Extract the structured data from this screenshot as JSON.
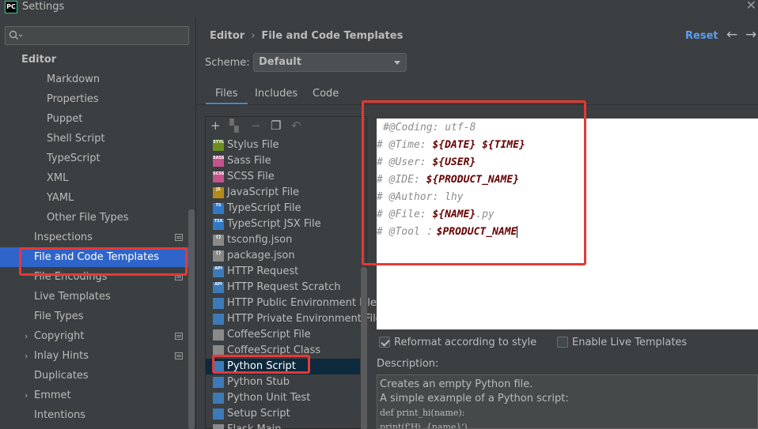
{
  "window": {
    "title": "Settings",
    "logo": "PC"
  },
  "sidebar": {
    "search_placeholder": "",
    "group_label": "Editor",
    "sub_items": [
      {
        "label": "Markdown"
      },
      {
        "label": "Properties"
      },
      {
        "label": "Puppet"
      },
      {
        "label": "Shell Script"
      },
      {
        "label": "TypeScript"
      },
      {
        "label": "XML"
      },
      {
        "label": "YAML"
      },
      {
        "label": "Other File Types"
      }
    ],
    "items": [
      {
        "label": "Inspections",
        "gear": true
      },
      {
        "label": "File and Code Templates",
        "selected": true
      },
      {
        "label": "File Encodings",
        "gear": true
      },
      {
        "label": "Live Templates"
      },
      {
        "label": "File Types"
      },
      {
        "label": "Copyright",
        "gear": true,
        "expandable": true
      },
      {
        "label": "Inlay Hints",
        "gear": true,
        "expandable": true
      },
      {
        "label": "Duplicates"
      },
      {
        "label": "Emmet",
        "expandable": true
      },
      {
        "label": "Intentions"
      }
    ]
  },
  "header": {
    "breadcrumb_root": "Editor",
    "breadcrumb_page": "File and Code Templates",
    "reset_label": "Reset"
  },
  "scheme": {
    "label": "Scheme:",
    "value": "Default"
  },
  "tabs": [
    {
      "label": "Files"
    },
    {
      "label": "Includes"
    },
    {
      "label": "Code"
    }
  ],
  "files": [
    {
      "label": "Stylus File",
      "icon": "stylus-file-icon",
      "tag": "STYL",
      "color": "#6b8e23"
    },
    {
      "label": "Sass File",
      "icon": "sass-file-icon",
      "tag": "SASS",
      "color": "#c6538c"
    },
    {
      "label": "SCSS File",
      "icon": "scss-file-icon",
      "tag": "SCSS",
      "color": "#c6538c"
    },
    {
      "label": "JavaScript File",
      "icon": "javascript-file-icon",
      "tag": "JS",
      "color": "#b38b1d"
    },
    {
      "label": "TypeScript File",
      "icon": "typescript-file-icon",
      "tag": "TS",
      "color": "#3178c6"
    },
    {
      "label": "TypeScript JSX File",
      "icon": "tsx-file-icon",
      "tag": "TSX",
      "color": "#3178c6"
    },
    {
      "label": "tsconfig.json",
      "icon": "json-file-icon",
      "tag": "{}",
      "color": "#8a8a8a"
    },
    {
      "label": "package.json",
      "icon": "json-file-icon",
      "tag": "{}",
      "color": "#8a8a8a"
    },
    {
      "label": "HTTP Request",
      "icon": "http-request-icon",
      "tag": "API",
      "color": "#3d7ab8"
    },
    {
      "label": "HTTP Request Scratch",
      "icon": "http-scratch-icon",
      "tag": "API",
      "color": "#3d7ab8"
    },
    {
      "label": "HTTP Public Environment File",
      "icon": "http-env-icon",
      "tag": "",
      "color": "#3d7ab8"
    },
    {
      "label": "HTTP Private Environment File",
      "icon": "http-env-icon",
      "tag": "",
      "color": "#3d7ab8"
    },
    {
      "label": "CoffeeScript File",
      "icon": "coffeescript-file-icon",
      "tag": "",
      "color": "#8a8a8a"
    },
    {
      "label": "CoffeeScript Class",
      "icon": "coffeescript-class-icon",
      "tag": "",
      "color": "#8a8a8a"
    },
    {
      "label": "Python Script",
      "icon": "python-file-icon",
      "tag": "",
      "color": "#3d7ab8",
      "selected": true
    },
    {
      "label": "Python Stub",
      "icon": "python-stub-icon",
      "tag": "",
      "color": "#3d7ab8"
    },
    {
      "label": "Python Unit Test",
      "icon": "python-test-icon",
      "tag": "",
      "color": "#3d7ab8"
    },
    {
      "label": "Setup Script",
      "icon": "setup-script-icon",
      "tag": "",
      "color": "#3d7ab8"
    },
    {
      "label": "Flask Main",
      "icon": "flask-icon",
      "tag": "",
      "color": "#8a8a8a"
    }
  ],
  "editor": {
    "lines": [
      {
        "comment": "#@Coding: utf-8",
        "var": "",
        "suffix": ""
      },
      {
        "comment": "# @Time: ",
        "var": "${DATE} ${TIME}",
        "suffix": ""
      },
      {
        "comment": "# @User: ",
        "var": "${USER}",
        "suffix": ""
      },
      {
        "comment": "# @IDE: ",
        "var": "${PRODUCT_NAME}",
        "suffix": ""
      },
      {
        "comment": "# @Author: lhy",
        "var": "",
        "suffix": ""
      },
      {
        "comment": "# @File: ",
        "var": "${NAME}",
        "suffix": ".py"
      },
      {
        "comment": "# @Tool ：",
        "var": "$PRODUCT_NAME",
        "suffix": ""
      }
    ]
  },
  "options": {
    "reformat_label": "Reformat according to style",
    "reformat_checked": true,
    "live_templates_label": "Enable Live Templates",
    "live_templates_checked": false
  },
  "description": {
    "label": "Description:",
    "line1": "Creates an empty Python file.",
    "line2": "A simple example of a Python script:",
    "code1": "def print_hi(name):",
    "code2": "    print(f'Hi, {name}')"
  },
  "colors": {
    "accent": "#2f65ca",
    "link": "#589df6",
    "annotation": "#e53935"
  }
}
